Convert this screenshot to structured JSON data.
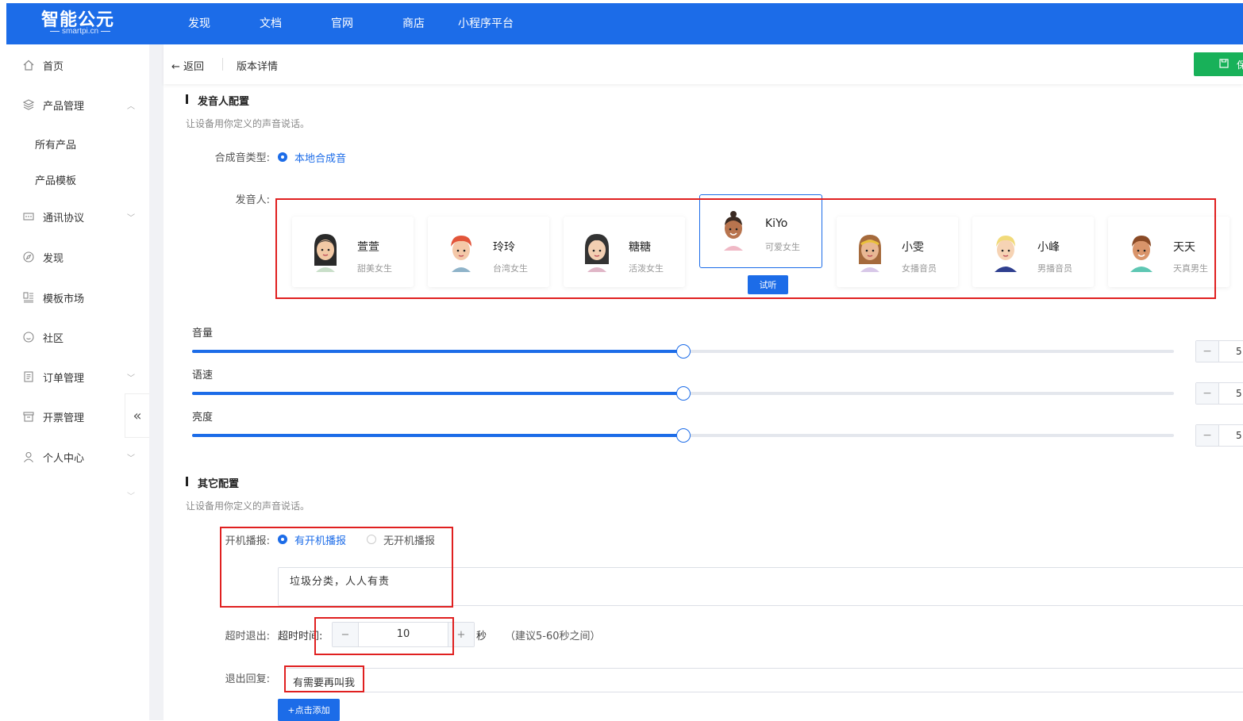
{
  "brand": {
    "name": "智能公元",
    "sub": "smartpi.cn"
  },
  "topnav": [
    "发现",
    "文档",
    "官网",
    "商店",
    "小程序平台"
  ],
  "sidebar": {
    "items": [
      {
        "label": "首页",
        "icon": "home-icon"
      },
      {
        "label": "产品管理",
        "icon": "layers-icon",
        "expanded": true
      },
      {
        "label": "通讯协议",
        "icon": "protocol-icon"
      },
      {
        "label": "发现",
        "icon": "compass-icon"
      },
      {
        "label": "模板市场",
        "icon": "template-icon"
      },
      {
        "label": "社区",
        "icon": "community-icon"
      },
      {
        "label": "订单管理",
        "icon": "order-icon"
      },
      {
        "label": "开票管理",
        "icon": "invoice-icon"
      },
      {
        "label": "个人中心",
        "icon": "user-icon"
      }
    ],
    "sub_items": [
      "所有产品",
      "产品模板"
    ]
  },
  "header": {
    "back": "返回",
    "title": "版本详情",
    "save": "保"
  },
  "speaker_section": {
    "title": "发音人配置",
    "desc": "让设备用你定义的声音说话。",
    "synth_label": "合成音类型:",
    "synth_option": "本地合成音",
    "speaker_label": "发音人:",
    "try_label": "试听",
    "voices": [
      {
        "name": "萱萱",
        "desc": "甜美女生",
        "selected": false
      },
      {
        "name": "玲玲",
        "desc": "台湾女生",
        "selected": false
      },
      {
        "name": "糖糖",
        "desc": "活泼女生",
        "selected": false
      },
      {
        "name": "KiYo",
        "desc": "可爱女生",
        "selected": true
      },
      {
        "name": "小雯",
        "desc": "女播音员",
        "selected": false
      },
      {
        "name": "小峰",
        "desc": "男播音员",
        "selected": false
      },
      {
        "name": "天天",
        "desc": "天真男生",
        "selected": false
      }
    ]
  },
  "sliders": [
    {
      "label": "音量",
      "value": 50,
      "display": "5"
    },
    {
      "label": "语速",
      "value": 50,
      "display": "5"
    },
    {
      "label": "亮度",
      "value": 50,
      "display": "5"
    }
  ],
  "other_section": {
    "title": "其它配置",
    "desc": "让设备用你定义的声音说话。",
    "boot_label": "开机播报:",
    "boot_on": "有开机播报",
    "boot_off": "无开机播报",
    "boot_text": "垃圾分类，人人有责",
    "timeout_label": "超时退出:",
    "timeout_sub": "超时时间:",
    "timeout_value": "10",
    "timeout_unit": "秒",
    "timeout_hint": "（建议5-60秒之间）",
    "exit_label": "退出回复:",
    "exit_text": "有需要再叫我",
    "add_label": "+点击添加"
  },
  "colors": {
    "primary": "#1c6ce8",
    "success": "#18b159",
    "highlight": "#e02020"
  }
}
